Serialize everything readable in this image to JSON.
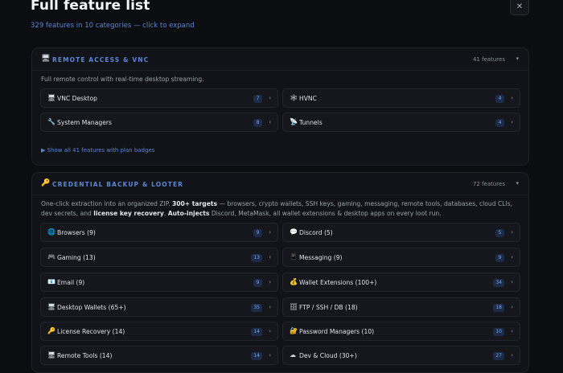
{
  "modal": {
    "title": "Full feature list",
    "subtitle": "329 features in 10 categories — click to expand",
    "close_label": "✕"
  },
  "remote": {
    "icon": "🖥",
    "title": "REMOTE ACCESS & VNC",
    "count": "41 features",
    "chevron": "▾",
    "description": "Full remote control with real-time desktop streaming.",
    "items": [
      {
        "icon": "🖥",
        "label": "VNC Desktop",
        "badge": "7",
        "chevron": "›"
      },
      {
        "icon": "🕸",
        "label": "HVNC",
        "badge": "4",
        "chevron": "›"
      },
      {
        "icon": "🔧",
        "label": "System Managers",
        "badge": "8",
        "chevron": "›"
      },
      {
        "icon": "📡",
        "label": "Tunnels",
        "badge": "4",
        "chevron": "›"
      }
    ],
    "show_all": "▶ Show all 41 features with plan badges"
  },
  "credential": {
    "icon": "🔑",
    "title": "CREDENTIAL BACKUP & LOOTER",
    "count": "72 features",
    "chevron": "▾",
    "desc_parts": {
      "a": "One-click extraction into an organized ZIP. ",
      "b": "300+ targets",
      "c": " — browsers, crypto wallets, SSH keys, gaming, messaging, remote tools, databases, cloud CLIs, dev secrets, and ",
      "d": "license key recovery",
      "e": ". ",
      "f": "Auto-injects",
      "g": " Discord, MetaMask, all wallet extensions & desktop apps on every loot run."
    },
    "items": [
      {
        "icon": "🌐",
        "label": "Browsers (9)",
        "badge": "9",
        "chevron": "›"
      },
      {
        "icon": "💬",
        "label": "Discord (5)",
        "badge": "5",
        "chevron": "›"
      },
      {
        "icon": "🎮",
        "label": "Gaming (13)",
        "badge": "13",
        "chevron": "›"
      },
      {
        "icon": "📱",
        "label": "Messaging (9)",
        "badge": "9",
        "chevron": "›"
      },
      {
        "icon": "📧",
        "label": "Email (9)",
        "badge": "9",
        "chevron": "›"
      },
      {
        "icon": "💰",
        "label": "Wallet Extensions (100+)",
        "badge": "34",
        "chevron": "›"
      },
      {
        "icon": "🖥",
        "label": "Desktop Wallets (65+)",
        "badge": "35",
        "chevron": "›"
      },
      {
        "icon": "🗄",
        "label": "FTP / SSH / DB (18)",
        "badge": "18",
        "chevron": "›"
      },
      {
        "icon": "🔑",
        "label": "License Recovery (14)",
        "badge": "14",
        "chevron": "›"
      },
      {
        "icon": "🔐",
        "label": "Password Managers (10)",
        "badge": "10",
        "chevron": "›"
      },
      {
        "icon": "🖥",
        "label": "Remote Tools (14)",
        "badge": "14",
        "chevron": "›"
      },
      {
        "icon": "☁",
        "label": "Dev & Cloud (30+)",
        "badge": "27",
        "chevron": "›"
      }
    ]
  }
}
